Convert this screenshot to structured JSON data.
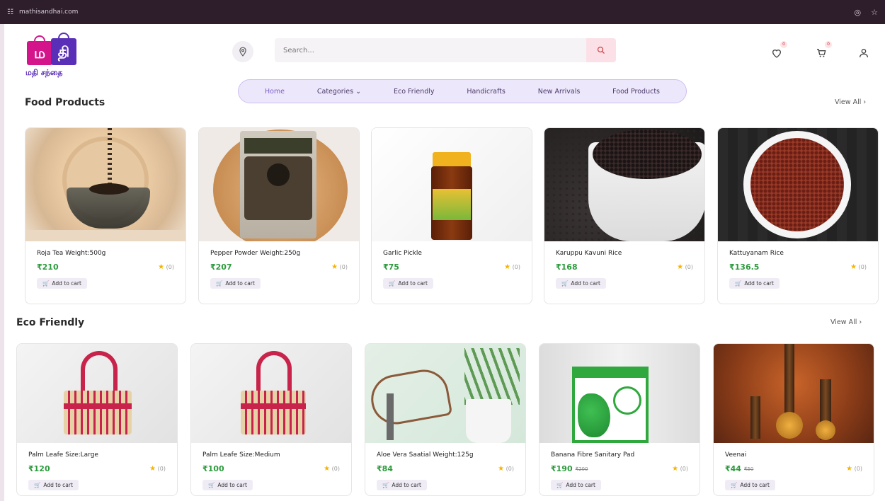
{
  "browser": {
    "url": "mathisandhai.com"
  },
  "logo": {
    "letters": [
      "ம",
      "தி"
    ],
    "tagline": "மதி சந்தை"
  },
  "search": {
    "placeholder": "Search..."
  },
  "header": {
    "wishlist_count": "0",
    "cart_count": "0"
  },
  "nav": {
    "items": [
      "Home",
      "Categories",
      "Eco Friendly",
      "Handicrafts",
      "New Arrivals",
      "Food Products"
    ]
  },
  "sections": [
    {
      "title": "Food Products",
      "view_all": "View All",
      "products": [
        {
          "name": "Roja Tea Weight:500g",
          "price": "₹210",
          "mrp": "",
          "rating": "(0)",
          "cart": "Add to cart"
        },
        {
          "name": "Pepper Powder Weight:250g",
          "price": "₹207",
          "mrp": "",
          "rating": "(0)",
          "cart": "Add to cart"
        },
        {
          "name": "Garlic Pickle",
          "price": "₹75",
          "mrp": "",
          "rating": "(0)",
          "cart": "Add to cart"
        },
        {
          "name": "Karuppu Kavuni Rice",
          "price": "₹168",
          "mrp": "",
          "rating": "(0)",
          "cart": "Add to cart"
        },
        {
          "name": "Kattuyanam Rice",
          "price": "₹136.5",
          "mrp": "",
          "rating": "(0)",
          "cart": "Add to cart"
        }
      ]
    },
    {
      "title": "Eco Friendly",
      "view_all": "View All",
      "products": [
        {
          "name": "Palm Leafe Size:Large",
          "price": "₹120",
          "mrp": "",
          "rating": "(0)",
          "cart": "Add to cart"
        },
        {
          "name": "Palm Leafe Size:Medium",
          "price": "₹100",
          "mrp": "",
          "rating": "(0)",
          "cart": "Add to cart"
        },
        {
          "name": "Aloe Vera Saatial Weight:125g",
          "price": "₹84",
          "mrp": "",
          "rating": "(0)",
          "cart": "Add to cart"
        },
        {
          "name": "Banana Fibre Sanitary Pad",
          "price": "₹190",
          "mrp": "₹200",
          "rating": "(0)",
          "cart": "Add to cart"
        },
        {
          "name": "Veenai",
          "price": "₹44",
          "mrp": "₹50",
          "rating": "(0)",
          "cart": "Add to cart"
        }
      ]
    }
  ],
  "colors": {
    "accent": "#7a5fc8",
    "price": "#2e9b3e",
    "brand_pink": "#d3148a",
    "brand_purple": "#5a2fb8"
  }
}
